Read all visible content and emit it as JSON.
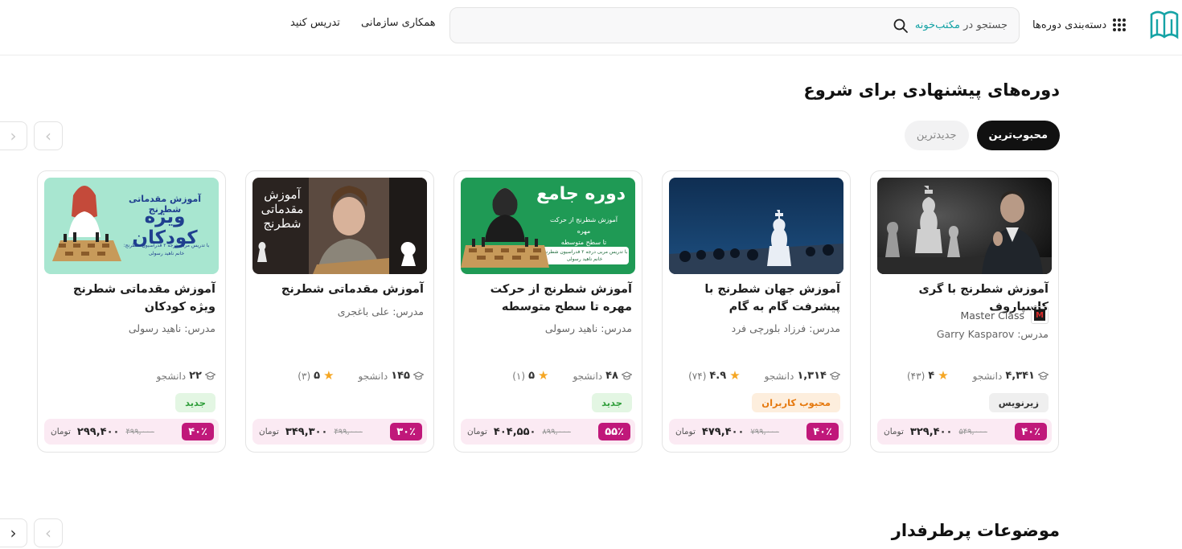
{
  "header": {
    "categories_label": "دسته‌بندی دوره‌ها",
    "search_prefix": "جستجو در",
    "search_brand": "مکتب‌خونه",
    "nav_business": "همکاری سازمانی",
    "nav_teach": "تدریس کنید"
  },
  "section1": {
    "title": "دوره‌های پیشنهادی برای شروع",
    "tabs": [
      "محبوب‌ترین",
      "جدیدترین"
    ]
  },
  "section2": {
    "title": "موضوعات پرطرفدار"
  },
  "labels": {
    "teacher_prefix": "مدرس:",
    "students": "دانشجو",
    "currency": "تومان"
  },
  "cards": [
    {
      "title": "آموزش شطرنج با گری کاسپاروف",
      "provider": "Master Class",
      "teacher": "مدرس: Garry Kasparov",
      "students": "۴,۳۴۱",
      "rating": "۴",
      "reviews": "(۴۳)",
      "badge": "زیرنویس",
      "discount": "۴۰٪",
      "old_price": "۵۴۹,۰۰۰",
      "price": "۳۲۹,۴۰۰",
      "colors": {
        "badge_bg": "#efefef",
        "badge_fg": "#333333"
      }
    },
    {
      "title": "آموزش جهان شطرنج با پیشرفت گام به گام",
      "teacher": "مدرس: فرزاد بلورچی فرد",
      "students": "۱,۳۱۴",
      "rating": "۴.۹",
      "reviews": "(۷۴)",
      "badge": "محبوب کاربران",
      "discount": "۴۰٪",
      "old_price": "۷۹۹,۰۰۰",
      "price": "۴۷۹,۴۰۰",
      "colors": {
        "badge_bg": "#fdeedd",
        "badge_fg": "#e5790f"
      }
    },
    {
      "title": "آموزش شطرنج از حرکت مهره تا سطح متوسطه",
      "teacher": "مدرس: ناهید رسولی",
      "students": "۴۸",
      "rating": "۵",
      "reviews": "(۱)",
      "badge": "جدید",
      "discount": "۵۵٪",
      "old_price": "۸۹۹,۰۰۰",
      "price": "۴۰۴,۵۵۰",
      "colors": {
        "badge_bg": "#e3f6e3",
        "badge_fg": "#2f9e3a"
      },
      "thumb_text": {
        "big": "دوره جامع",
        "line1": "آموزش شطرنج از حرکت مهره",
        "line2": "تا سطح متوسطه",
        "line3": "با تدریس مربی درجه ۲ فدراسیون شطرنج:",
        "line4": "خانم ناهید رسولی"
      }
    },
    {
      "title": "آموزش مقدماتی شطرنج",
      "teacher": "مدرس: علی باغجری",
      "students": "۱۴۵",
      "rating": "۵",
      "reviews": "(۳)",
      "discount": "۳۰٪",
      "old_price": "۴۹۹,۰۰۰",
      "price": "۳۴۹,۳۰۰",
      "thumb_text": {
        "big": "آموزش مقدماتی شطرنج"
      }
    },
    {
      "title": "آموزش مقدماتی شطرنج ویژه کودکان",
      "teacher": "مدرس: ناهید رسولی",
      "students": "۲۲",
      "badge": "جدید",
      "discount": "۴۰٪",
      "old_price": "۴۹۹,۰۰۰",
      "price": "۲۹۹,۴۰۰",
      "colors": {
        "badge_bg": "#e3f6e3",
        "badge_fg": "#2f9e3a"
      },
      "thumb_text": {
        "small": "آموزش مقدماتی شطرنج",
        "big": "ویژه کودکان",
        "line3": "با تدریس مربی درجه ۲ فدراسیون شطرنج:",
        "line4": "خانم ناهید رسولی"
      }
    }
  ],
  "colors": {
    "accent": "#15a3a5",
    "discount": "#c0187a",
    "price_bar": "#fbeaf3",
    "star": "#f5a623"
  }
}
